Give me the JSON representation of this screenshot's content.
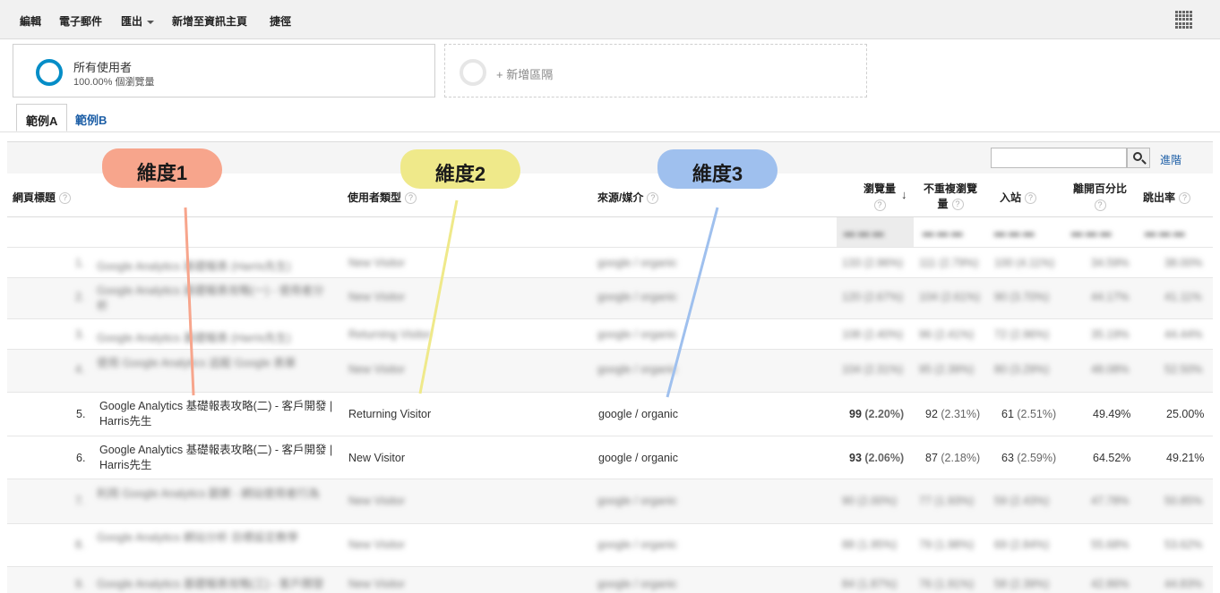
{
  "toolbar": {
    "items": [
      {
        "label": "編輯"
      },
      {
        "label": "電子郵件"
      },
      {
        "label": "匯出"
      },
      {
        "label": "新增至資訊主頁"
      },
      {
        "label": "捷徑"
      }
    ]
  },
  "segments": {
    "active": {
      "name": "所有使用者",
      "sub": "100.00% 個瀏覽量"
    },
    "add_label": "+ 新增區隔"
  },
  "tabs": [
    {
      "label": "範例A"
    },
    {
      "label": "範例B"
    }
  ],
  "search": {
    "placeholder": "",
    "advanced_label": "進階"
  },
  "columns": {
    "page_title": "網頁標題",
    "user_type": "使用者類型",
    "source_medium": "來源/媒介",
    "pageviews": "瀏覽量",
    "unique_pageviews_1": "不重複瀏覽",
    "unique_pageviews_2": "量",
    "entrances": "入站",
    "exit_rate": "離開百分比",
    "bounce_rate": "跳出率",
    "help": "?"
  },
  "rows": [
    {
      "num": "1.",
      "title": "Google Analytics 基礎報表 (Harris先生)",
      "user_type": "New Visitor",
      "source": "google / organic",
      "pv": "133 (2.96%)",
      "upv": "111 (2.79%)",
      "ent": "100 (4.11%)",
      "exit": "34.59%",
      "bounce": "38.00%"
    },
    {
      "num": "2.",
      "title": "Google Analytics 基礎報表攻略(一) - 使用者分析",
      "user_type": "New Visitor",
      "source": "google / organic",
      "pv": "120 (2.67%)",
      "upv": "104 (2.61%)",
      "ent": "90 (3.70%)",
      "exit": "44.17%",
      "bounce": "41.11%"
    },
    {
      "num": "3.",
      "title": "Google Analytics 基礎報表 (Harris先生)",
      "user_type": "Returning Visitor",
      "source": "google / organic",
      "pv": "108 (2.40%)",
      "upv": "96 (2.41%)",
      "ent": "72 (2.96%)",
      "exit": "35.19%",
      "bounce": "44.44%"
    },
    {
      "num": "4.",
      "title": "使用 Google Analytics 追蹤 Google 表單",
      "user_type": "New Visitor",
      "source": "google / organic",
      "pv": "104 (2.31%)",
      "upv": "95 (2.39%)",
      "ent": "80 (3.29%)",
      "exit": "48.08%",
      "bounce": "52.50%"
    },
    {
      "num": "5.",
      "title": "Google Analytics 基礎報表攻略(二) - 客戶開發 | Harris先生",
      "user_type": "Returning Visitor",
      "source": "google / organic",
      "pv_val": "99",
      "pv_pct": "(2.20%)",
      "upv_val": "92",
      "upv_pct": "(2.31%)",
      "ent_val": "61",
      "ent_pct": "(2.51%)",
      "exit": "49.49%",
      "bounce": "25.00%"
    },
    {
      "num": "6.",
      "title": "Google Analytics 基礎報表攻略(二) - 客戶開發 | Harris先生",
      "user_type": "New Visitor",
      "source": "google / organic",
      "pv_val": "93",
      "pv_pct": "(2.06%)",
      "upv_val": "87",
      "upv_pct": "(2.18%)",
      "ent_val": "63",
      "ent_pct": "(2.59%)",
      "exit": "64.52%",
      "bounce": "49.21%"
    },
    {
      "num": "7.",
      "title": "利用 Google Analytics 觀察 - 網站使用者行為",
      "user_type": "New Visitor",
      "source": "google / organic",
      "pv": "90 (2.00%)",
      "upv": "77 (1.93%)",
      "ent": "59 (2.43%)",
      "exit": "47.78%",
      "bounce": "50.85%"
    },
    {
      "num": "8.",
      "title": "Google Analytics 網站分析 目標設定教學",
      "user_type": "New Visitor",
      "source": "google / organic",
      "pv": "88 (1.95%)",
      "upv": "79 (1.98%)",
      "ent": "69 (2.84%)",
      "exit": "55.68%",
      "bounce": "53.62%"
    },
    {
      "num": "9.",
      "title": "Google Analytics 基礎報表攻略(三) - 客戶開發",
      "user_type": "New Visitor",
      "source": "google / organic",
      "pv": "84 (1.87%)",
      "upv": "76 (1.91%)",
      "ent": "58 (2.39%)",
      "exit": "42.86%",
      "bounce": "44.83%"
    }
  ],
  "annotations": [
    {
      "label": "維度1",
      "color": "#f7a58c"
    },
    {
      "label": "維度2",
      "color": "#efe98a"
    },
    {
      "label": "維度3",
      "color": "#9fc0ee"
    }
  ]
}
